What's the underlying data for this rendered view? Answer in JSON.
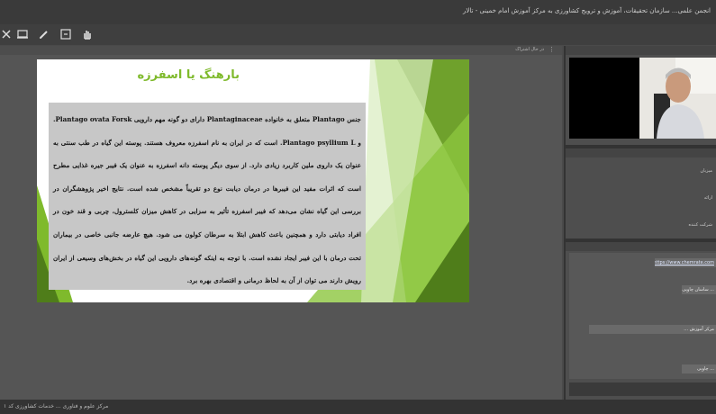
{
  "window": {
    "title": "انجمن علمی... سازمان تحقیقات، آموزش و ترویج کشاورزی به مرکز آموزش امام خمینی - تالار"
  },
  "slide": {
    "heading": "بارهنگ یا اسفرزه",
    "body": "جنس Plantago متعلق به خانواده Plantaginaceae دارای دو گونه مهم دارویی Plantago ovata Forsk. و Plantago psyllium L. است که در ایران به نام اسفرزه معروف هستند. پوسته این گیاه در طب سنتی به عنوان یک داروی ملین کاربرد زیادی دارد. از سوی دیگر پوسته دانه اسفرزه به عنوان یک فیبر جیره غذایی مطرح است که اثرات مفید این فیبرها در درمان دیابت نوع دو تقریباً مشخص شده است. نتایج اخیر پژوهشگران در بررسی این گیاه نشان می‌دهد که فیبر اسفرزه تأثیر به سزایی در کاهش میزان کلسترول، چربی و قند خون در افراد دیابتی دارد و همچنین باعث کاهش ابتلا به سرطان کولون می شود. هیچ عارضه جانبی خاصی در بیماران تحت درمان با این فیبر ایجاد نشده است. با توجه به اینکه گونه‌های دارویی این گیاه در بخش‌های وسیعی از ایران رویش دارند می توان از آن به لحاظ درمانی و اقتصادی بهره برد."
  },
  "chat": {
    "link": "https://www.chemrate.com/...",
    "messages": [
      "... ساسان چاوپی",
      "مرکز آموزش ...",
      "... چاوپی"
    ]
  },
  "status": {
    "text": "مرکز علوم و فناوری ... خدمات کشاورزی کد ۱"
  },
  "colors": {
    "accent_green": "#7fba2c",
    "toolbar_bg": "#3f3f3f",
    "pane_bg": "#555555"
  },
  "icons": [
    "close-icon",
    "screen-share-icon",
    "pencil-icon",
    "whiteboard-icon",
    "hand-icon",
    "chat-icon",
    "mic-icon",
    "camera-icon"
  ]
}
